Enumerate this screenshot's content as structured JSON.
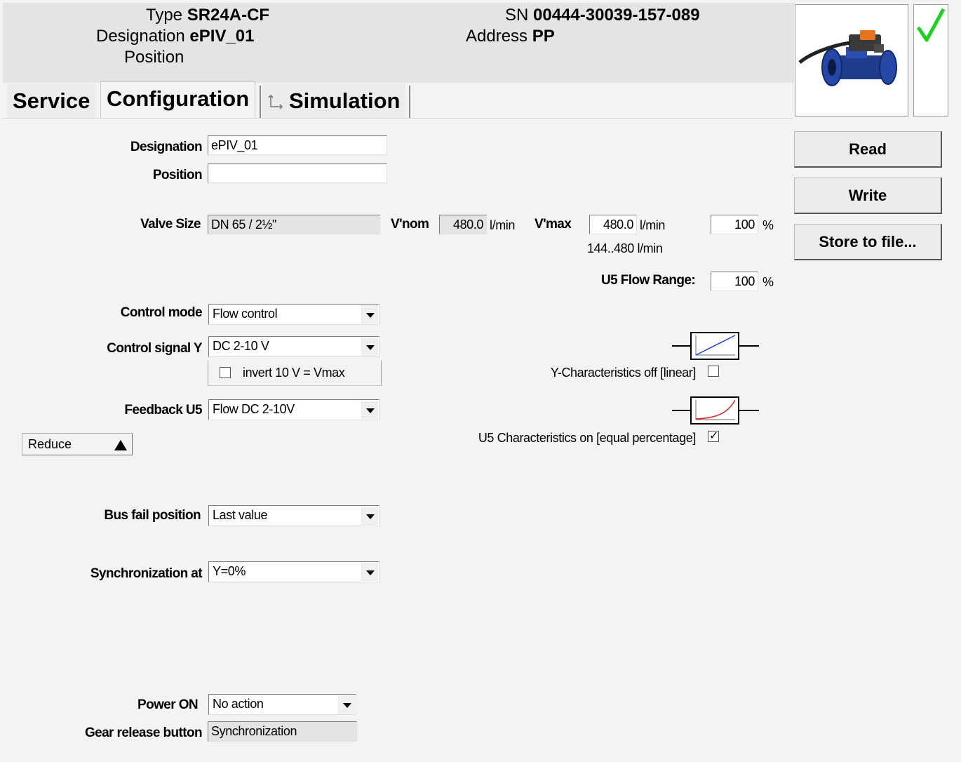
{
  "header": {
    "type_label": "Type",
    "type_value": "SR24A-CF",
    "designation_label": "Designation",
    "designation_value": "ePIV_01",
    "position_label": "Position",
    "sn_label": "SN",
    "sn_value": "00444-30039-157-089",
    "address_label": "Address",
    "address_value": "PP"
  },
  "status_icon": "check-icon",
  "status_color": "#1fd11f",
  "tabs": [
    {
      "label": "Service"
    },
    {
      "label": "Configuration"
    },
    {
      "label": "Simulation"
    }
  ],
  "actions": {
    "read": "Read",
    "write": "Write",
    "store": "Store to file..."
  },
  "form": {
    "designation_label": "Designation",
    "designation_value": "ePIV_01",
    "position_label": "Position",
    "position_value": "",
    "valve_size_label": "Valve Size",
    "valve_size_value": "DN 65 / 2½\"",
    "vnom_label": "V'nom",
    "vnom_value": "480.0",
    "vnom_unit": "l/min",
    "vmax_label": "V'max",
    "vmax_value": "480.0",
    "vmax_unit": "l/min",
    "vmax_percent": "100",
    "percent_unit": "%",
    "vmax_range": "144..480 l/min",
    "u5_flow_range_label": "U5 Flow Range:",
    "u5_flow_range_value": "100",
    "control_mode_label": "Control mode",
    "control_mode_value": "Flow control",
    "control_signal_label": "Control signal Y",
    "control_signal_value": "DC 2-10 V",
    "invert_label": "invert 10 V = Vmax",
    "invert_checked": false,
    "feedback_label": "Feedback U5",
    "feedback_value": "Flow DC 2-10V",
    "reduce_label": "Reduce",
    "y_char_label": "Y-Characteristics off [linear]",
    "y_char_checked": false,
    "u5_char_label": "U5 Characteristics on [equal percentage]",
    "u5_char_checked": true,
    "bus_fail_label": "Bus fail position",
    "bus_fail_value": "Last value",
    "sync_label": "Synchronization at",
    "sync_value": "Y=0%",
    "power_on_label": "Power ON",
    "power_on_value": "No action",
    "gear_release_label": "Gear release button",
    "gear_release_value": "Synchronization"
  },
  "colors": {
    "linear_curve": "#2a3fd6",
    "equal_pct_curve": "#d62a2a"
  }
}
